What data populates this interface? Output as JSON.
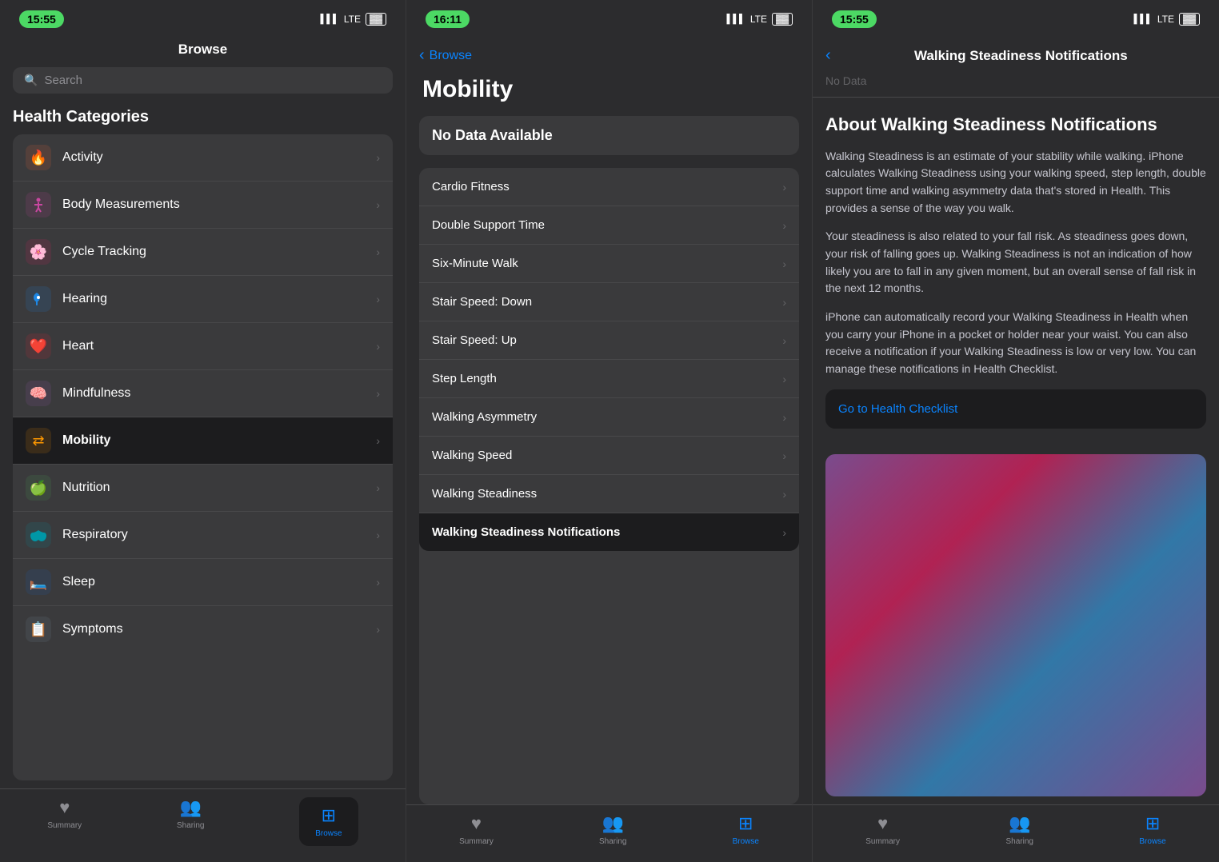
{
  "panels": {
    "browse": {
      "time": "15:55",
      "signal": "▌▌▌",
      "network": "LTE",
      "battery": "▓▓▓",
      "title": "Browse",
      "search_placeholder": "Search",
      "section_heading": "Health Categories",
      "categories": [
        {
          "id": "activity",
          "icon": "🔥",
          "label": "Activity",
          "selected": false
        },
        {
          "id": "body",
          "icon": "🧍",
          "label": "Body Measurements",
          "selected": false
        },
        {
          "id": "cycle",
          "icon": "🌸",
          "label": "Cycle Tracking",
          "selected": false
        },
        {
          "id": "hearing",
          "icon": "👂",
          "label": "Hearing",
          "selected": false
        },
        {
          "id": "heart",
          "icon": "❤️",
          "label": "Heart",
          "selected": false
        },
        {
          "id": "mindfulness",
          "icon": "🧠",
          "label": "Mindfulness",
          "selected": false
        },
        {
          "id": "mobility",
          "icon": "↔️",
          "label": "Mobility",
          "selected": true
        },
        {
          "id": "nutrition",
          "icon": "🍎",
          "label": "Nutrition",
          "selected": false
        },
        {
          "id": "respiratory",
          "icon": "🫁",
          "label": "Respiratory",
          "selected": false
        },
        {
          "id": "sleep",
          "icon": "🛏️",
          "label": "Sleep",
          "selected": false
        },
        {
          "id": "symptoms",
          "icon": "📋",
          "label": "Symptoms",
          "selected": false
        }
      ],
      "tabs": [
        {
          "id": "summary",
          "icon": "♥",
          "label": "Summary",
          "active": false
        },
        {
          "id": "sharing",
          "icon": "👥",
          "label": "Sharing",
          "active": false
        },
        {
          "id": "browse",
          "icon": "⊞",
          "label": "Browse",
          "active": true
        }
      ]
    },
    "mobility": {
      "time": "16:11",
      "signal": "▌▌▌",
      "network": "LTE",
      "battery": "▓▓▓",
      "back_label": "Browse",
      "title": "Mobility",
      "no_data_text": "No Data Available",
      "items": [
        {
          "id": "cardio",
          "label": "Cardio Fitness",
          "selected": false
        },
        {
          "id": "double",
          "label": "Double Support Time",
          "selected": false
        },
        {
          "id": "sixmin",
          "label": "Six-Minute Walk",
          "selected": false
        },
        {
          "id": "stair_down",
          "label": "Stair Speed: Down",
          "selected": false
        },
        {
          "id": "stair_up",
          "label": "Stair Speed: Up",
          "selected": false
        },
        {
          "id": "step",
          "label": "Step Length",
          "selected": false
        },
        {
          "id": "asym",
          "label": "Walking Asymmetry",
          "selected": false
        },
        {
          "id": "speed",
          "label": "Walking Speed",
          "selected": false
        },
        {
          "id": "steadiness",
          "label": "Walking Steadiness",
          "selected": false
        },
        {
          "id": "notifications",
          "label": "Walking Steadiness Notifications",
          "selected": true
        }
      ],
      "tabs": [
        {
          "id": "summary",
          "icon": "♥",
          "label": "Summary",
          "active": false
        },
        {
          "id": "sharing",
          "icon": "👥",
          "label": "Sharing",
          "active": false
        },
        {
          "id": "browse",
          "icon": "⊞",
          "label": "Browse",
          "active": true
        }
      ]
    },
    "notifications": {
      "time": "15:55",
      "signal": "▌▌▌",
      "network": "LTE",
      "battery": "▓▓▓",
      "back_label": "",
      "title": "Walking Steadiness Notifications",
      "no_data": "No Data",
      "about_title": "About Walking Steadiness Notifications",
      "paragraphs": [
        "Walking Steadiness is an estimate of your stability while walking. iPhone calculates Walking Steadiness using your walking speed, step length, double support time and walking asymmetry data that's stored in Health. This provides a sense of the way you walk.",
        "Your steadiness is also related to your fall risk. As steadiness goes down, your risk of falling goes up. Walking Steadiness is not an indication of how likely you are to fall in any given moment, but an overall sense of fall risk in the next 12 months.",
        "iPhone can automatically record your Walking Steadiness in Health when you carry your iPhone in a pocket or holder near your waist. You can also receive a notification if your Walking Steadiness is low or very low. You can manage these notifications in Health Checklist."
      ],
      "checklist_label": "Go to Health Checklist",
      "tabs": [
        {
          "id": "summary",
          "icon": "♥",
          "label": "Summary",
          "active": false
        },
        {
          "id": "sharing",
          "icon": "👥",
          "label": "Sharing",
          "active": false
        },
        {
          "id": "browse",
          "icon": "⊞",
          "label": "Browse",
          "active": true
        }
      ]
    }
  }
}
